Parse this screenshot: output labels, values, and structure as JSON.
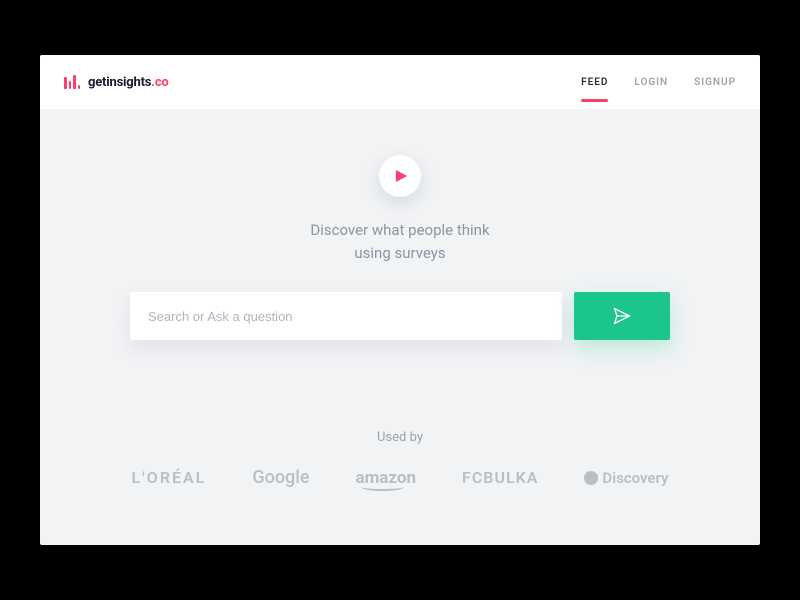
{
  "brand": {
    "name_main": "getinsights",
    "name_accent": ".co"
  },
  "nav": {
    "feed": "FEED",
    "login": "LOGIN",
    "signup": "SIGNUP"
  },
  "hero": {
    "tagline_line1": "Discover what people think",
    "tagline_line2": "using surveys",
    "search_placeholder": "Search or Ask a question"
  },
  "usedby": {
    "label": "Used by",
    "logos": {
      "loreal": "L'ORÉAL",
      "google": "Google",
      "amazon": "amazon",
      "fcbulka": "FCBULKA",
      "discovery": "Discovery"
    }
  },
  "colors": {
    "accent": "#ff3d6a",
    "cta": "#1cc58b",
    "bg": "#f1f3f5"
  }
}
